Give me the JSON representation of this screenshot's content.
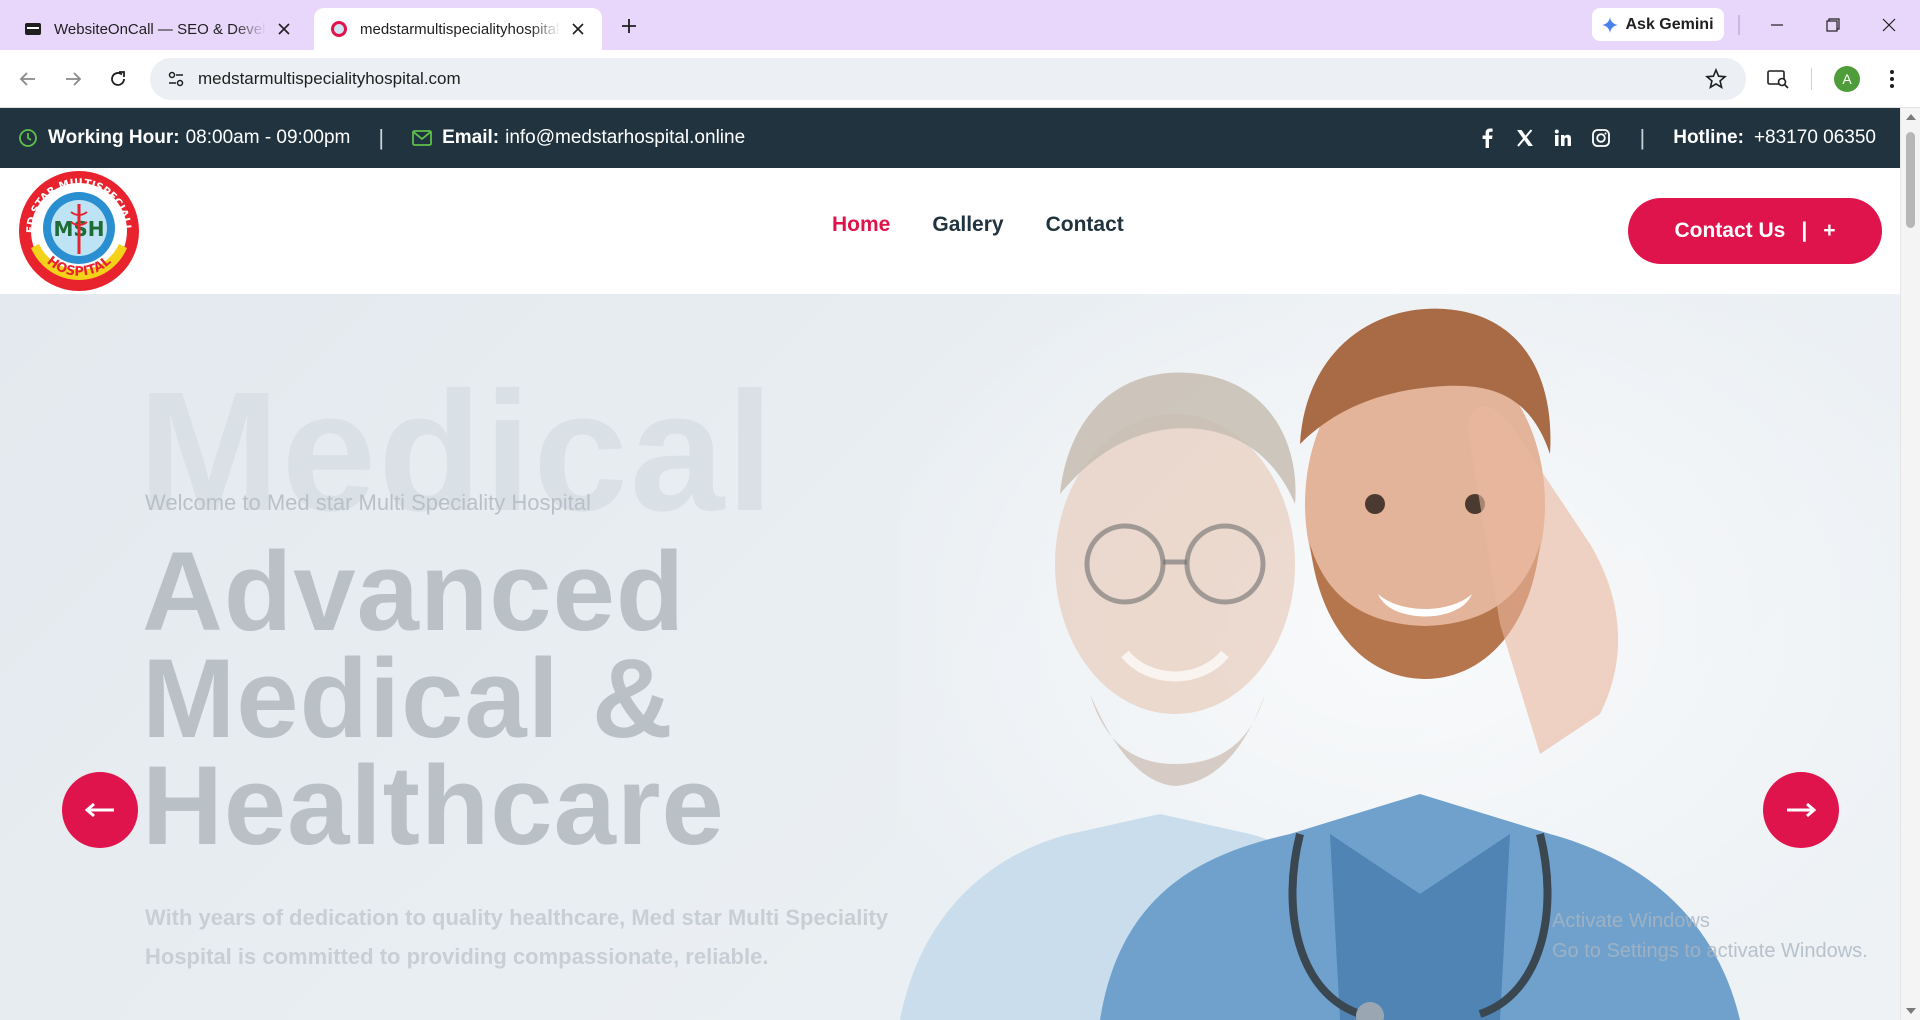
{
  "browser": {
    "tabs": [
      {
        "title": "WebsiteOnCall — SEO & Development",
        "active": false
      },
      {
        "title": "medstarmultispecialityhospital.com",
        "active": true
      }
    ],
    "gemini_label": "Ask Gemini",
    "url": "medstarmultispecialityhospital.com",
    "profile_initial": "A"
  },
  "topbar": {
    "hours_label": "Working Hour:",
    "hours_value": "08:00am - 09:00pm",
    "email_label": "Email:",
    "email_value": "info@medstarhospital.online",
    "hotline_label": "Hotline:",
    "hotline_value": "+83170 06350",
    "social": [
      "facebook-icon",
      "x-icon",
      "linkedin-icon",
      "instagram-icon"
    ]
  },
  "header": {
    "logo_text_top": "MED STAR MULTISPECIALITY",
    "logo_text_bottom": "HOSPITAL",
    "logo_initials": "MSH",
    "nav": [
      "Home",
      "Gallery",
      "Contact"
    ],
    "active_nav": "Home",
    "contact_button": "Contact Us",
    "contact_button_icon": "+"
  },
  "hero": {
    "bg_word": "Medical",
    "welcome": "Welcome to Med star Multi Speciality Hospital",
    "title_line1": "Advanced",
    "title_line2": "Medical &",
    "title_line3": "Healthcare",
    "description": "With years of dedication to quality healthcare, Med star Multi Speciality Hospital is committed to providing compassionate, reliable.",
    "caption_line1": "Activate Windows",
    "caption_line2": "Go to Settings to activate Windows."
  },
  "colors": {
    "accent": "#e0144c",
    "topbar_bg": "#20333f",
    "tabbar_bg": "#e9d7fb",
    "text_dark": "#20333f"
  }
}
